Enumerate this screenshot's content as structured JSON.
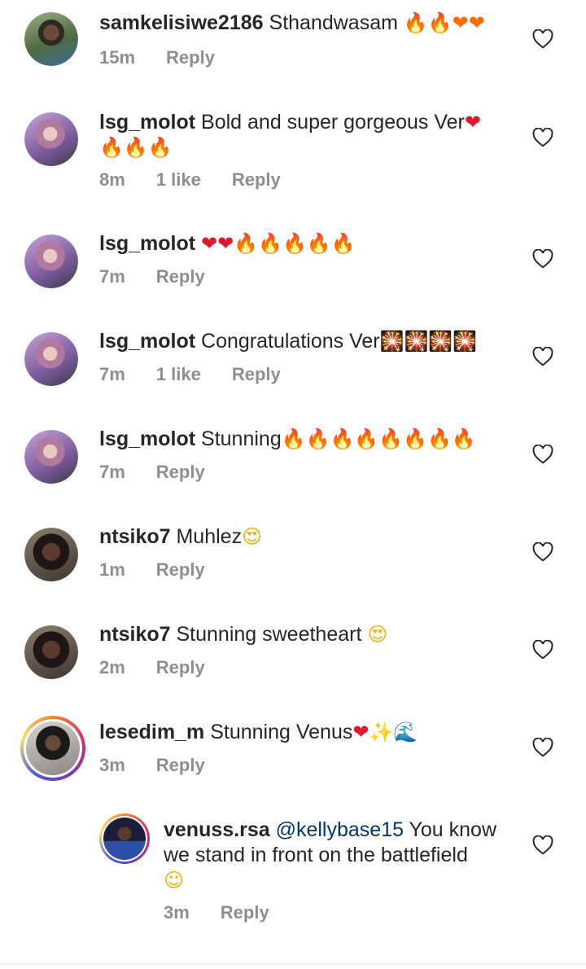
{
  "comments": [
    {
      "user": "samkelisiwe2186",
      "text": "Sthandwasam",
      "emoji": "🔥🔥❤❤",
      "time": "15m",
      "likes": "",
      "reply": "Reply"
    },
    {
      "user": "lsg_molot",
      "text": "Bold and super gorgeous Ver",
      "emoji": "❤",
      "emoji2": "🔥🔥🔥",
      "time": "8m",
      "likes": "1 like",
      "reply": "Reply"
    },
    {
      "user": "lsg_molot",
      "text": "",
      "emoji": "❤❤🔥🔥🔥🔥🔥",
      "time": "7m",
      "likes": "",
      "reply": "Reply"
    },
    {
      "user": "lsg_molot",
      "text": "Congratulations Ver",
      "emoji": "🎇🎇🎇🎇",
      "time": "7m",
      "likes": "1 like",
      "reply": "Reply"
    },
    {
      "user": "lsg_molot",
      "text": "Stunning",
      "emoji": "🔥🔥🔥🔥🔥🔥🔥🔥",
      "time": "7m",
      "likes": "",
      "reply": "Reply"
    },
    {
      "user": "ntsiko7",
      "text": "Muhlez",
      "emoji": "😍",
      "time": "1m",
      "likes": "",
      "reply": "Reply"
    },
    {
      "user": "ntsiko7",
      "text": "Stunning sweetheart",
      "emoji": "😍",
      "time": "2m",
      "likes": "",
      "reply": "Reply"
    },
    {
      "user": "lesedim_m",
      "text": "Stunning Venus",
      "emoji": "❤✨🌊",
      "time": "3m",
      "likes": "",
      "reply": "Reply"
    },
    {
      "user": "venuss.rsa",
      "mention": "@kellybase15",
      "text": "You know we stand in front on the battlefield",
      "emoji": "☺",
      "time": "3m",
      "likes": "",
      "reply": "Reply"
    }
  ],
  "colors": {
    "text": "#262626",
    "meta": "#8e8e8e",
    "mention": "#00376b"
  }
}
